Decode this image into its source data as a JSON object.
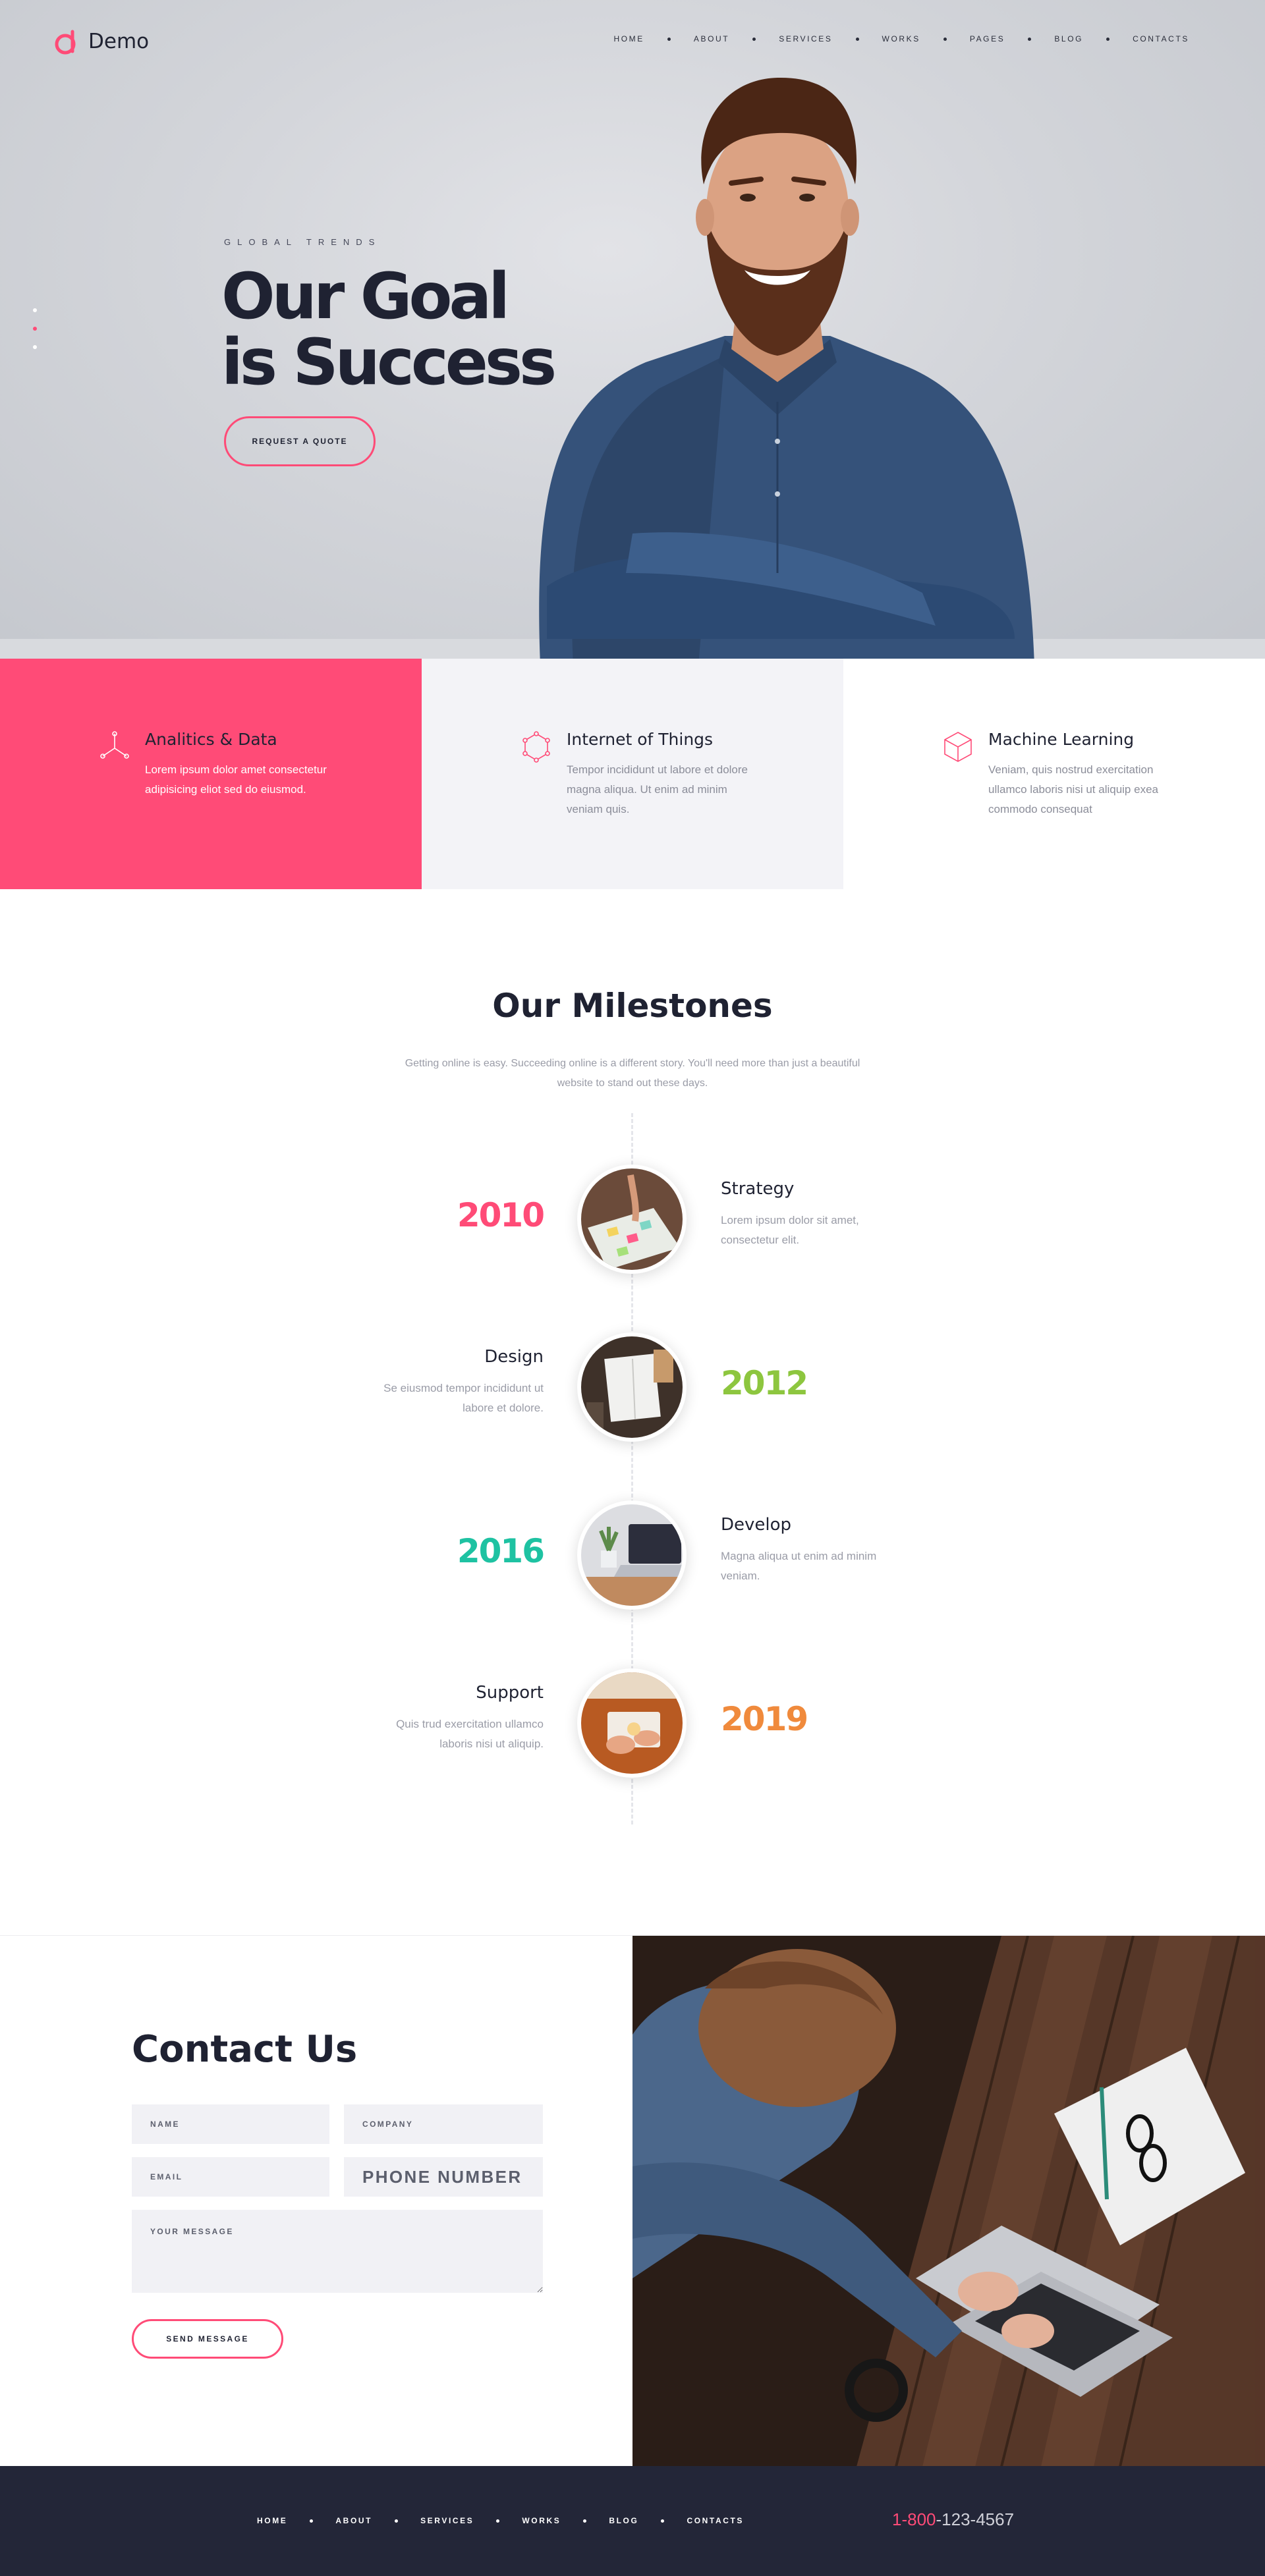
{
  "brand": {
    "name": "Demo",
    "accent": "#ff4b77"
  },
  "nav": {
    "items": [
      "HOME",
      "ABOUT",
      "SERVICES",
      "WORKS",
      "PAGES",
      "BLOG",
      "CONTACTS"
    ]
  },
  "hero": {
    "eyebrow": "GLOBAL TRENDS",
    "title_line1": "Our Goal",
    "title_line2": "is Success",
    "cta": "REQUEST A QUOTE",
    "slides": 3,
    "active_slide": 2
  },
  "features": [
    {
      "title": "Analitics & Data",
      "text": "Lorem ipsum dolor amet consectetur adipisicing eliot sed do eiusmod.",
      "icon": "analytics-icon"
    },
    {
      "title": "Internet of Things",
      "text": "Tempor incididunt ut labore et dolore magna aliqua. Ut enim ad minim veniam quis.",
      "icon": "hexagon-network-icon"
    },
    {
      "title": "Machine Learning",
      "text": "Veniam, quis nostrud exercitation ullamco laboris nisi ut aliquip exea commodo consequat",
      "icon": "cube-icon"
    }
  ],
  "milestones": {
    "title": "Our Milestones",
    "subtitle": "Getting online is easy. Succeeding online is a different story. You'll need more than just a beautiful website to stand out these days.",
    "items": [
      {
        "year": "2010",
        "name": "Strategy",
        "desc": "Lorem ipsum dolor sit amet, consectetur elit.",
        "color": "#ff4b77",
        "image": "strategy-photo"
      },
      {
        "year": "2012",
        "name": "Design",
        "desc": "Se eiusmod tempor incididunt ut labore et dolore.",
        "color": "#8dc63f",
        "image": "design-photo"
      },
      {
        "year": "2016",
        "name": "Develop",
        "desc": "Magna aliqua ut enim ad minim veniam.",
        "color": "#1ec2a2",
        "image": "develop-photo"
      },
      {
        "year": "2019",
        "name": "Support",
        "desc": "Quis trud exercitation ullamco laboris nisi ut aliquip.",
        "color": "#f08a3c",
        "image": "support-photo"
      }
    ]
  },
  "contact": {
    "title": "Contact Us",
    "name_placeholder": "NAME",
    "company_placeholder": "COMPANY",
    "email_placeholder": "EMAIL",
    "phone_placeholder": "PHONE NUMBER",
    "message_placeholder": "YOUR MESSAGE",
    "submit": "SEND MESSAGE"
  },
  "footer": {
    "nav": [
      "HOME",
      "ABOUT",
      "SERVICES",
      "WORKS",
      "BLOG",
      "CONTACTS"
    ],
    "phone_prefix": "1-800",
    "phone_rest": "-123-4567"
  }
}
